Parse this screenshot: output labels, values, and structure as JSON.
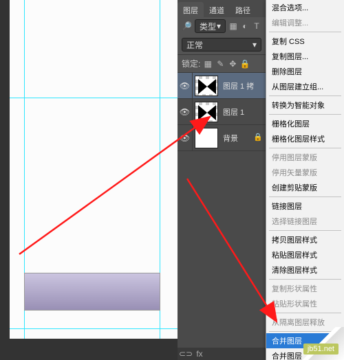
{
  "panel": {
    "tabs": [
      "图层",
      "通道",
      "路径"
    ],
    "kind_label": "类型",
    "blend_mode": "正常",
    "lock_label": "锁定:"
  },
  "layers": [
    {
      "name": "图层 1 拷",
      "selected": true
    },
    {
      "name": "图层 1",
      "selected": false
    },
    {
      "name": "背景",
      "selected": false,
      "bg": true
    }
  ],
  "menu": {
    "g1": [
      "混合选项...",
      "编辑调整..."
    ],
    "g2": [
      "复制 CSS",
      "复制图层...",
      "删除图层",
      "从图层建立组..."
    ],
    "g3": [
      "转换为智能对象"
    ],
    "g4": [
      "栅格化图层",
      "栅格化图层样式"
    ],
    "g5": [
      "停用图层蒙版",
      "停用矢量蒙版",
      "创建剪贴蒙版"
    ],
    "g6": [
      "链接图层",
      "选择链接图层"
    ],
    "g7": [
      "拷贝图层样式",
      "粘贴图层样式",
      "清除图层样式"
    ],
    "g8": [
      "复制形状属性",
      "粘贴形状属性"
    ],
    "g9": [
      "从隔离图层释放"
    ],
    "g10": [
      "合并图层",
      "合并图层"
    ]
  },
  "watermark": "jb51.net"
}
